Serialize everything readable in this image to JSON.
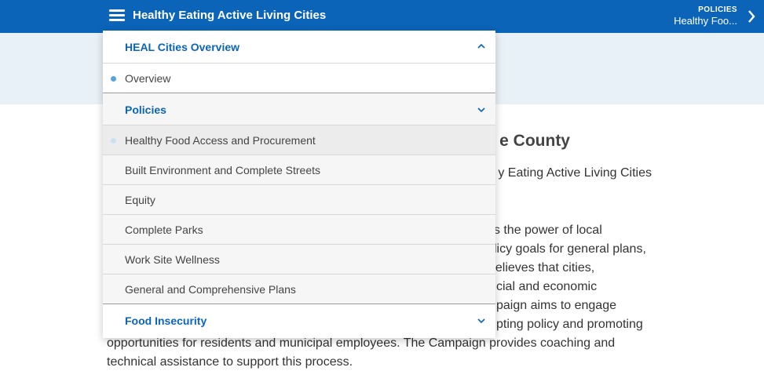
{
  "header": {
    "title": "Healthy Eating Active Living Cities",
    "breadcrumb_label": "POLICIES",
    "breadcrumb_value": "Healthy Foo..."
  },
  "content": {
    "heading_visible": "e County",
    "subtitle_visible": "y Eating Active Living Cities",
    "lines": [
      "ess the power of local",
      "licy goals for general plans,",
      "believes that cities,",
      "cial and economic",
      "paign aims to engage",
      "pting policy and promoting",
      "opportunities for residents and municipal employees. The Campaign provides coaching and",
      "technical assistance to support this process."
    ]
  },
  "menu": {
    "sections": [
      {
        "label": "HEAL Cities Overview",
        "expanded": true
      },
      {
        "label": "Policies",
        "expanded": true
      },
      {
        "label": "Food Insecurity",
        "expanded": false
      }
    ],
    "overview_items": [
      {
        "label": "Overview"
      }
    ],
    "policy_items": [
      {
        "label": "Healthy Food Access and Procurement",
        "active": true
      },
      {
        "label": "Built Environment and Complete Streets"
      },
      {
        "label": "Equity"
      },
      {
        "label": "Complete Parks"
      },
      {
        "label": "Work Site Wellness"
      },
      {
        "label": "General and Comprehensive Plans"
      }
    ]
  },
  "colors": {
    "header_blue": "#0b64b7",
    "hero_bg": "#e9f1f8",
    "bullet_blue": "#56a4dc"
  },
  "icons": [
    "hamburger-menu-icon",
    "chevron-right-icon",
    "chevron-up-icon",
    "chevron-down-icon",
    "bullet-dot-icon"
  ]
}
